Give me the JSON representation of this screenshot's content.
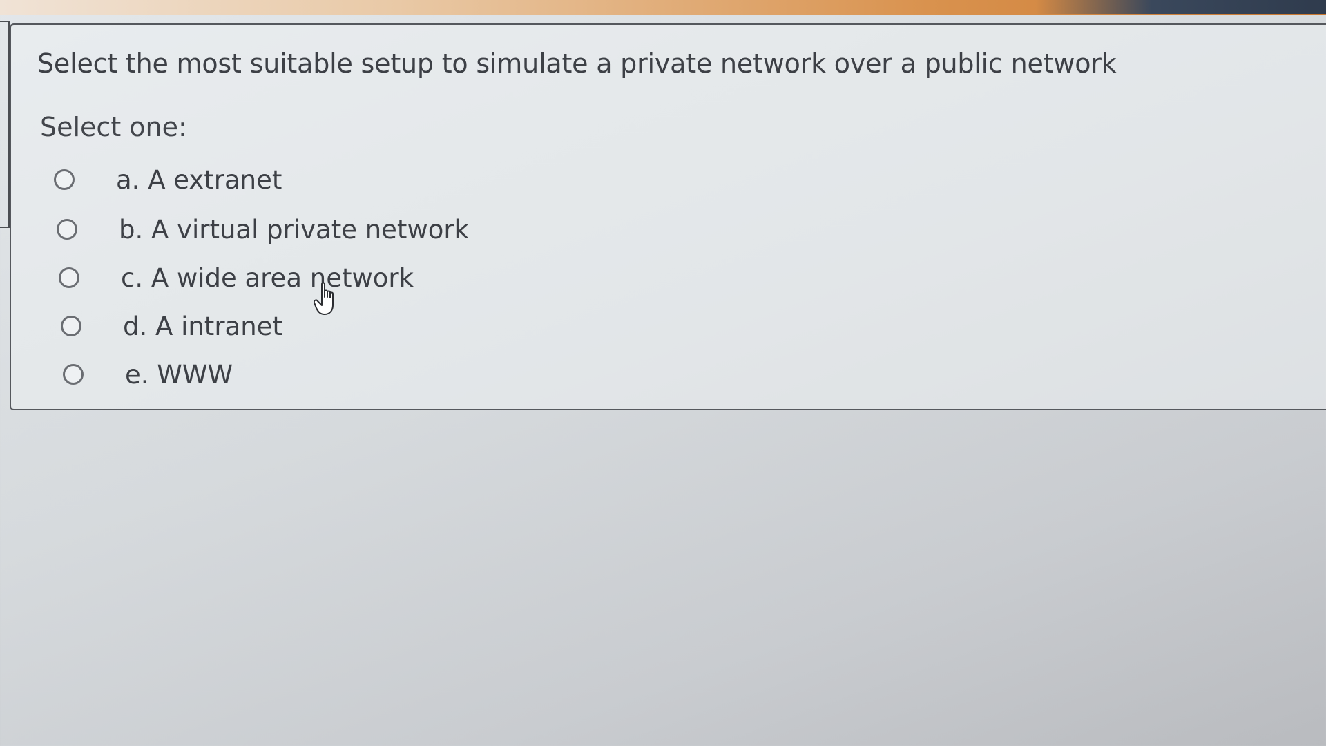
{
  "question": {
    "text": "Select the most suitable setup to simulate a private network over a public network",
    "instruction": "Select one:",
    "options": [
      {
        "label": "a. A extranet",
        "selected": false
      },
      {
        "label": "b. A virtual private network",
        "selected": false
      },
      {
        "label": "c. A wide area network",
        "selected": false
      },
      {
        "label": "d. A intranet",
        "selected": false
      },
      {
        "label": "e. WWW",
        "selected": false
      }
    ]
  },
  "cursor": {
    "icon": "hand-pointer-icon"
  },
  "colors": {
    "text": "#3d4046",
    "border": "#55585d",
    "accent_strip": "#d9924e"
  }
}
